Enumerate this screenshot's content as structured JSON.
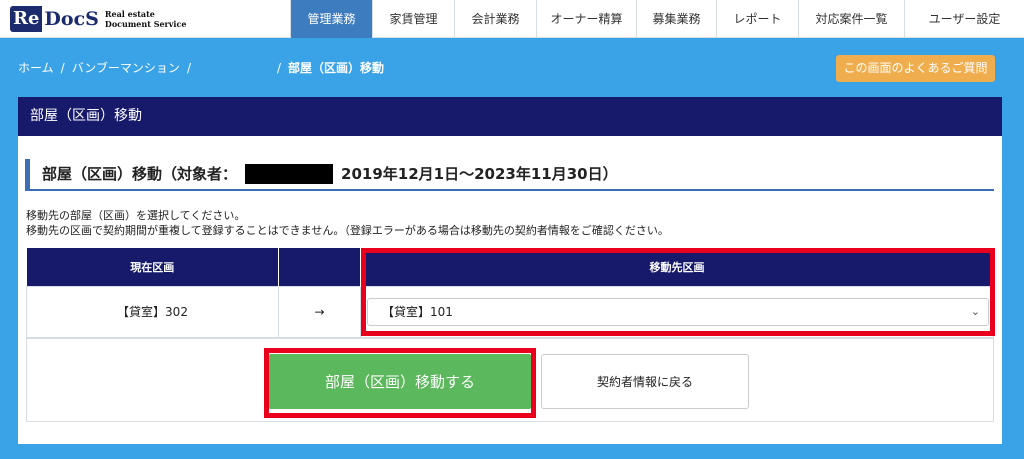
{
  "header": {
    "logo_mark_re": "Re",
    "logo_mark_docs": "DocS",
    "logo_sub_1": "Real estate",
    "logo_sub_2": "Document Service",
    "nav": [
      {
        "label": "管理業務",
        "active": true
      },
      {
        "label": "家賃管理",
        "active": false
      },
      {
        "label": "会計業務",
        "active": false
      },
      {
        "label": "オーナー精算",
        "active": false
      },
      {
        "label": "募集業務",
        "active": false
      },
      {
        "label": "レポート",
        "active": false
      },
      {
        "label": "対応案件一覧",
        "active": false
      },
      {
        "label": "ユーザー設定",
        "active": false
      }
    ]
  },
  "breadcrumb": {
    "home": "ホーム",
    "property": "バンブーマンション",
    "current": "部屋（区画）移動"
  },
  "faq_button": "この画面のよくあるご質問",
  "panel": {
    "title": "部屋（区画）移動",
    "section_title_prefix": "部屋（区画）移動（対象者：",
    "section_title_period": "2019年12月1日〜2023年11月30日）",
    "desc_line1": "移動先の部屋（区画）を選択してください。",
    "desc_line2": "移動先の区画で契約期間が重複して登録することはできません。（登録エラーがある場合は移動先の契約者情報をご確認ください。",
    "table": {
      "col_current": "現在区画",
      "col_arrow": "",
      "col_target": "移動先区画",
      "current_value": "【貸室】302",
      "arrow": "→",
      "target_value": "【貸室】101"
    },
    "move_button": "部屋（区画）移動する",
    "back_button": "契約者情報に戻る"
  },
  "colors": {
    "background": "#3aa3e8",
    "navy": "#171a6b",
    "active_nav": "#3d7cbf",
    "faq": "#f0ad4e",
    "primary": "#5cb85c",
    "highlight": "#e8001c"
  }
}
